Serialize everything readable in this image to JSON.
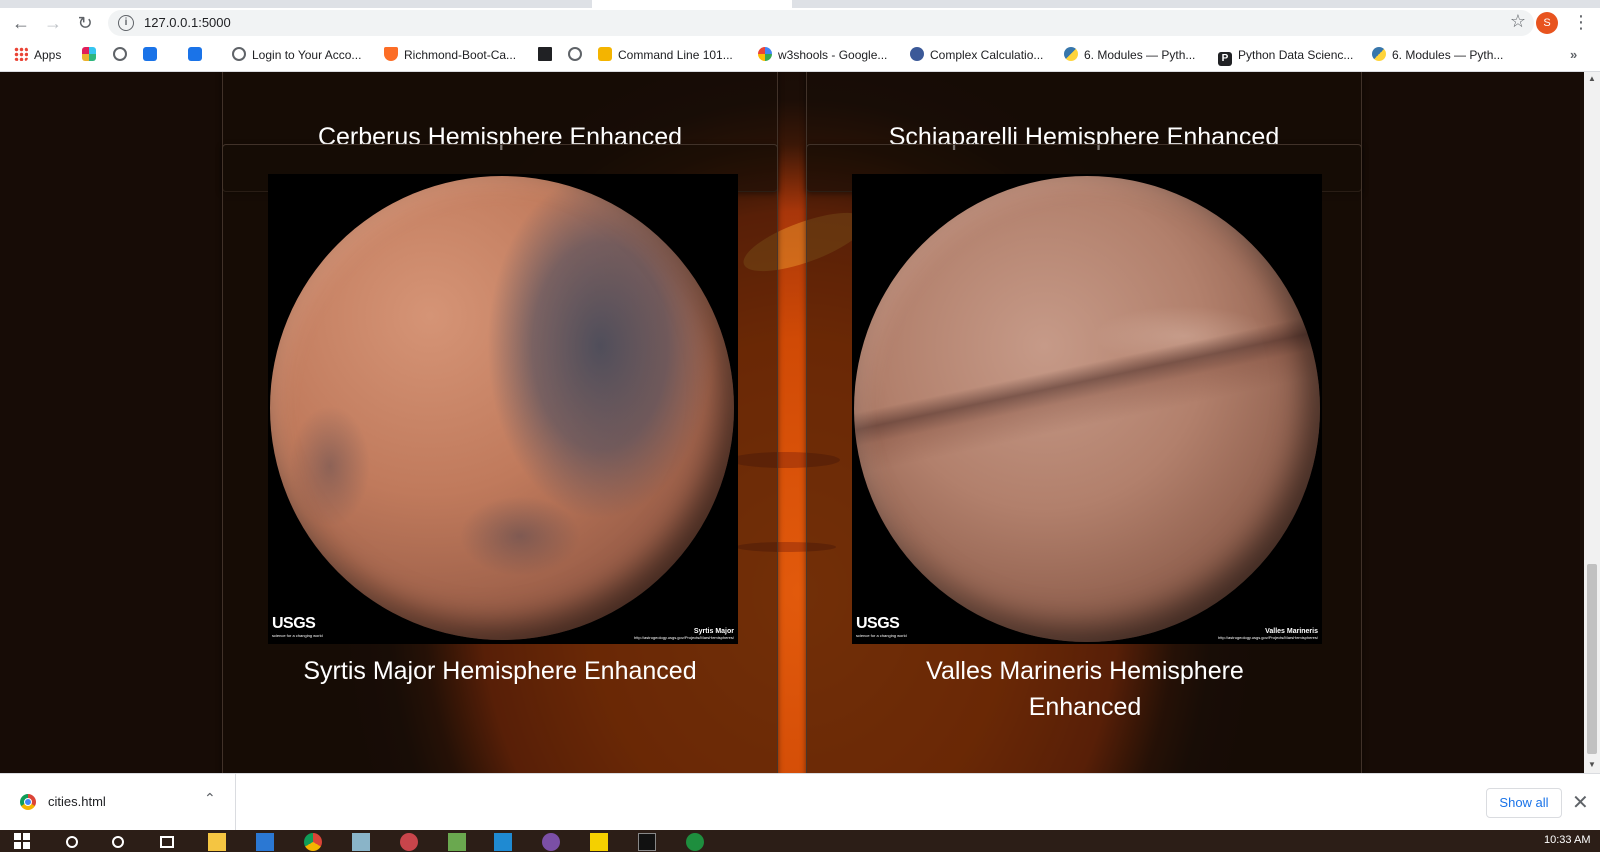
{
  "browser": {
    "url": "127.0.0.1:5000",
    "profile_initial": "S",
    "bookmarks": [
      {
        "label": "Apps",
        "icon": "apps-grid-icon",
        "color": "#ea4335"
      },
      {
        "label": "",
        "icon": "slack-icon",
        "color": "#e01e5a"
      },
      {
        "label": "",
        "icon": "globe-icon",
        "color": "#5f6368"
      },
      {
        "label": "",
        "icon": "bookmark-square-icon",
        "color": "#1a73e8"
      },
      {
        "label": "",
        "icon": "bookmark-square-icon",
        "color": "#1a73e8"
      },
      {
        "label": "Login to Your Acco...",
        "icon": "globe-icon",
        "color": "#5f6368"
      },
      {
        "label": "Richmond-Boot-Ca...",
        "icon": "gitlab-icon",
        "color": "#fc6d26"
      },
      {
        "label": "",
        "icon": "book-icon",
        "color": "#202124"
      },
      {
        "label": "",
        "icon": "globe-icon",
        "color": "#5f6368"
      },
      {
        "label": "Command Line 101...",
        "icon": "terminal-icon",
        "color": "#f4b400"
      },
      {
        "label": "w3shools - Google...",
        "icon": "google-icon",
        "color": "#4285f4"
      },
      {
        "label": "Complex Calculatio...",
        "icon": "calculator-icon",
        "color": "#3b5998"
      },
      {
        "label": "6. Modules — Pyth...",
        "icon": "python-icon",
        "color": "#3776ab"
      },
      {
        "label": "Python Data Scienc...",
        "icon": "p-badge-icon",
        "color": "#202124"
      },
      {
        "label": "6. Modules — Pyth...",
        "icon": "python-icon",
        "color": "#3776ab"
      }
    ]
  },
  "cards": [
    {
      "title": "Cerberus Hemisphere Enhanced"
    },
    {
      "title": "Schiaparelli Hemisphere Enhanced"
    },
    {
      "title": "Syrtis Major Hemisphere Enhanced",
      "image_credit_name": "Syrtis Major",
      "image_credit_url": "http://astrogeology.usgs.gov/Projects/MarsHemispheres/"
    },
    {
      "title": "Valles Marineris Hemisphere Enhanced",
      "image_credit_name": "Valles Marineris",
      "image_credit_url": "http://astrogeology.usgs.gov/Projects/MarsHemispheres/"
    }
  ],
  "usgs": {
    "logo_text": "USGS",
    "tagline": "science for a changing world"
  },
  "downloads": {
    "file_name": "cities.html",
    "show_all_label": "Show all"
  },
  "taskbar": {
    "time": "10:33 AM"
  }
}
